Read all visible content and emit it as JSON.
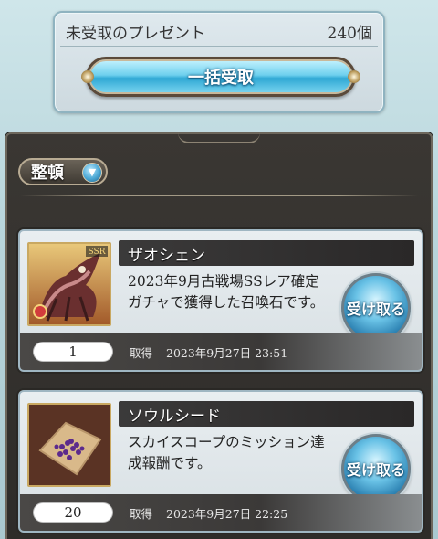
{
  "summary": {
    "label": "未受取のプレゼント",
    "count": "240個",
    "claim_all_label": "一括受取"
  },
  "sort": {
    "label": "整頓",
    "icon": "chevron-down-icon"
  },
  "items": [
    {
      "name": "ザオシェン",
      "description": "2023年9月古戦場SSレア確定ガチャで獲得した召喚石です。",
      "quantity": "1",
      "acquired_label": "取得",
      "acquired_date": "2023年9月27日  23:51",
      "claim_label": "受け取る",
      "thumbnail_badge": "SSR"
    },
    {
      "name": "ソウルシード",
      "description": "スカイスコープのミッション達成報酬です。",
      "quantity": "20",
      "acquired_label": "取得",
      "acquired_date": "2023年9月27日  22:25",
      "claim_label": "受け取る"
    }
  ]
}
